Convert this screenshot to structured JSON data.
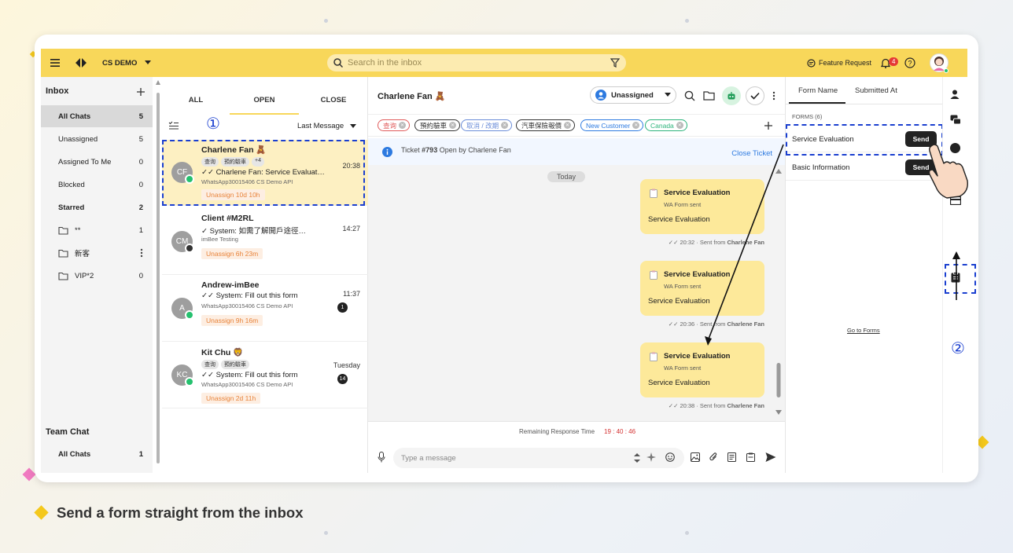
{
  "app": {
    "workspace": "CS DEMO"
  },
  "topbar": {
    "search_placeholder": "Search in the inbox",
    "feature_request": "Feature Request",
    "notification_count": "4"
  },
  "inbox": {
    "title": "Inbox",
    "items": [
      {
        "label": "All Chats",
        "count": "5"
      },
      {
        "label": "Unassigned",
        "count": "5"
      },
      {
        "label": "Assigned To Me",
        "count": "0"
      },
      {
        "label": "Blocked",
        "count": "0"
      }
    ],
    "starred": {
      "label": "Starred",
      "count": "2"
    },
    "folders": [
      {
        "label": "**",
        "count": "1"
      },
      {
        "label": "新客",
        "count": ""
      },
      {
        "label": "VIP*2",
        "count": "0"
      }
    ],
    "team_chat": {
      "title": "Team Chat",
      "label": "All Chats",
      "count": "1"
    }
  },
  "chatlist": {
    "tabs": [
      "ALL",
      "OPEN",
      "CLOSE"
    ],
    "sort": "Last Message",
    "chats": [
      {
        "name": "Charlene Fan 🧸",
        "initials": "CF",
        "tags": [
          "查询",
          "預約驗車",
          "+4"
        ],
        "message": "Charlene Fan: Service Evaluat…",
        "sub": "WhatsApp30015406 CS Demo API",
        "time": "20:38",
        "unassign": "Unassign 10d 10h",
        "count": ""
      },
      {
        "name": "Client #M2RL",
        "initials": "CM",
        "tags": [],
        "message": "System: 如需了解開戶途徑…",
        "sub": "imBee Testing",
        "time": "14:27",
        "unassign": "Unassign 6h 23m",
        "count": ""
      },
      {
        "name": "Andrew-imBee",
        "initials": "A",
        "tags": [],
        "message": "System: Fill out this form",
        "sub": "WhatsApp30015406 CS Demo API",
        "time": "11:37",
        "unassign": "Unassign 9h 16m",
        "count": "1"
      },
      {
        "name": "Kit Chu 🦁",
        "initials": "KC",
        "tags": [
          "查询",
          "預約驗車"
        ],
        "message": "System: Fill out this form",
        "sub": "WhatsApp30015406 CS Demo API",
        "time": "Tuesday",
        "unassign": "Unassign 2d 11h",
        "count": "14"
      }
    ]
  },
  "conversation": {
    "contact": "Charlene Fan 🧸",
    "assignee": "Unassigned",
    "tags": [
      {
        "label": "查询",
        "color": "#e05a5a"
      },
      {
        "label": "預約驗車",
        "color": "#333333"
      },
      {
        "label": "取消 / 改期",
        "color": "#6a8cd8"
      },
      {
        "label": "汽車保險報價",
        "color": "#333333"
      },
      {
        "label": "New Customer",
        "color": "#2d7ae0"
      },
      {
        "label": "Canada",
        "color": "#2bb37a"
      }
    ],
    "ticket": {
      "text_prefix": "Ticket ",
      "number": "#793",
      "text_suffix": " Open by Charlene Fan",
      "close": "Close Ticket"
    },
    "date_divider": "Today",
    "messages": [
      {
        "title": "Service Evaluation",
        "status": "WA Form sent",
        "body": "Service Evaluation",
        "meta_prefix": "20:32 · Sent from ",
        "sender": "Charlene Fan"
      },
      {
        "title": "Service Evaluation",
        "status": "WA Form sent",
        "body": "Service Evaluation",
        "meta_prefix": "20:36 · Sent from ",
        "sender": "Charlene Fan"
      },
      {
        "title": "Service Evaluation",
        "status": "WA Form sent",
        "body": "Service Evaluation",
        "meta_prefix": "20:38 · Sent from ",
        "sender": "Charlene Fan"
      }
    ],
    "remaining_label": "Remaining Response Time",
    "remaining_value": "19 : 40 : 46",
    "compose_placeholder": "Type a message"
  },
  "forms": {
    "tabs": [
      "Form Name",
      "Submitted At"
    ],
    "section": "FORMS (6)",
    "items": [
      {
        "name": "Service Evaluation",
        "send": "Send"
      },
      {
        "name": "Basic Information",
        "send": "Send"
      }
    ],
    "go_to_forms": "Go to Forms"
  },
  "annotations": {
    "step1": "①",
    "step2": "②"
  },
  "caption": "Send a form straight from the inbox",
  "colors": {
    "accent": "#f8d75a",
    "highlight": "#1a3fd0",
    "unassign": "#e8833a"
  }
}
